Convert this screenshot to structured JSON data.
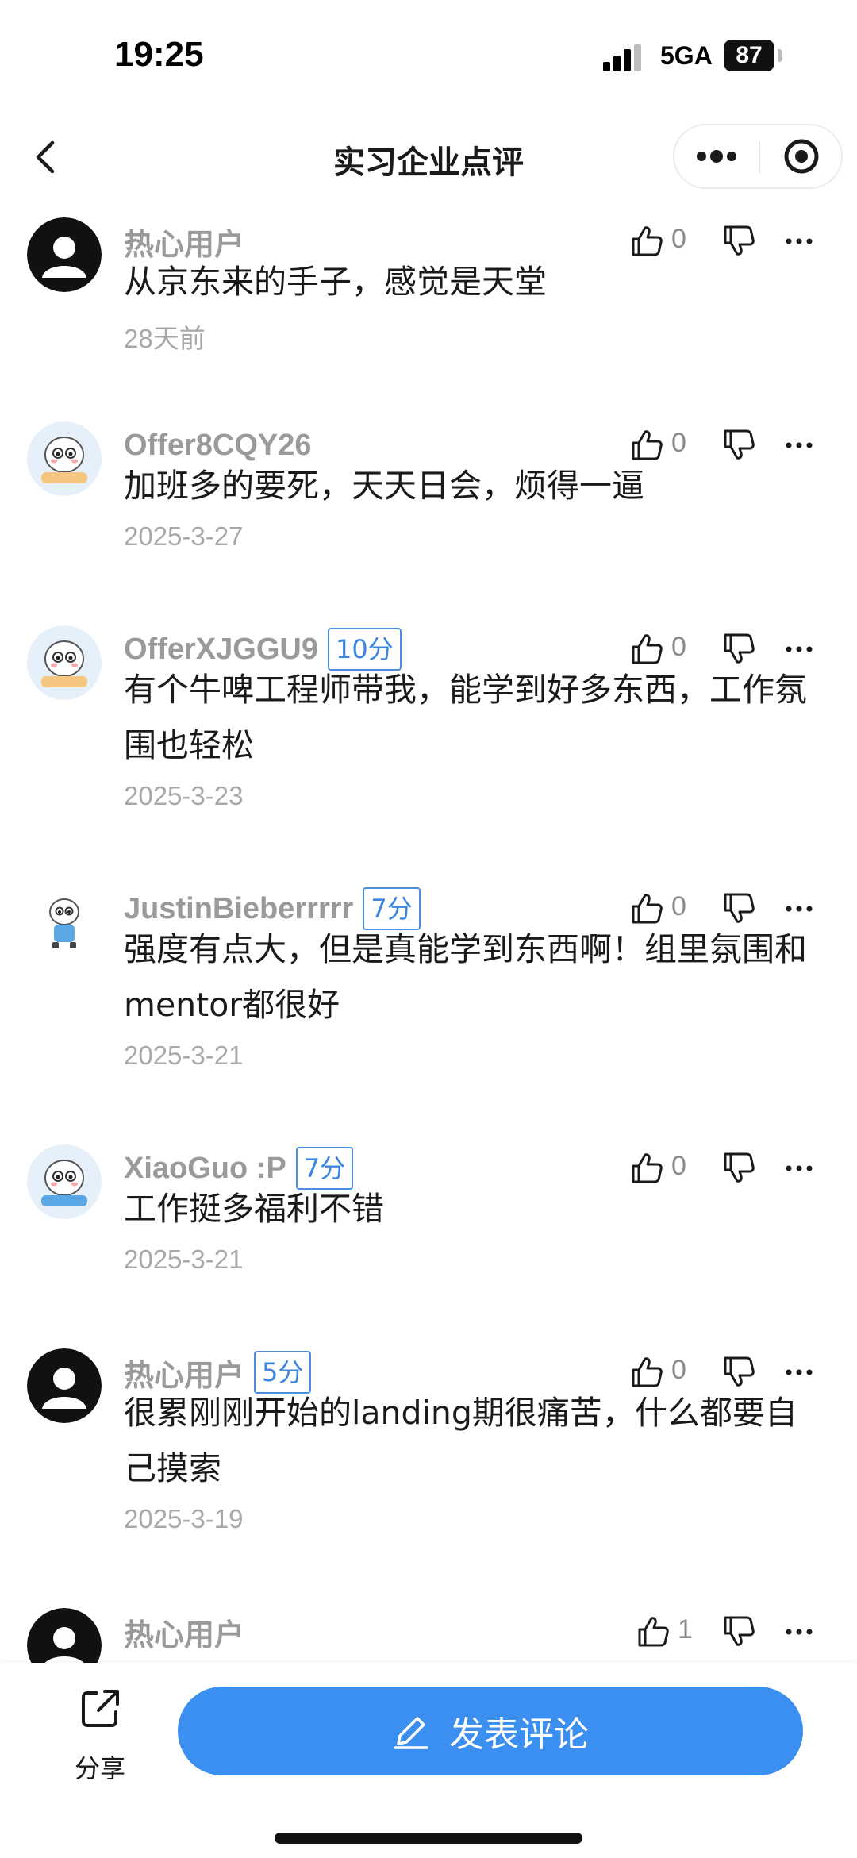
{
  "status_bar": {
    "time": "19:25",
    "network": "5GA",
    "battery": "87"
  },
  "nav": {
    "title": "实习企业点评",
    "back_icon": "chevron-left-icon",
    "menu_icon": "more-dots-icon",
    "close_icon": "target-circle-icon"
  },
  "comments": [
    {
      "username": "热心用户",
      "avatar": "default-user-avatar",
      "score": "",
      "likes": "0",
      "text": "从京东来的手子，感觉是天堂",
      "date": "28天前"
    },
    {
      "username": "Offer8CQY26",
      "avatar": "cartoon-mascot-avatar",
      "score": "",
      "likes": "0",
      "text": "加班多的要死，天天日会，烦得一逼",
      "date": "2025-3-27"
    },
    {
      "username": "OfferXJGGU9",
      "avatar": "cartoon-mascot-avatar",
      "score": "10分",
      "likes": "0",
      "text": "有个牛啤工程师带我，能学到好多东西，工作氛围也轻松",
      "date": "2025-3-23"
    },
    {
      "username": "JustinBieberrrrr",
      "avatar": "cartoon-mascot-small-avatar",
      "score": "7分",
      "likes": "0",
      "text": "强度有点大，但是真能学到东西啊！组里氛围和mentor都很好",
      "date": "2025-3-21"
    },
    {
      "username": "XiaoGuo :P",
      "avatar": "cartoon-mascot-avatar",
      "score": "7分",
      "likes": "0",
      "text": "工作挺多福利不错",
      "date": "2025-3-21"
    },
    {
      "username": "热心用户",
      "avatar": "default-user-avatar",
      "score": "5分",
      "likes": "0",
      "text": "很累刚刚开始的landing期很痛苦，什么都要自己摸索",
      "date": "2025-3-19"
    },
    {
      "username": "热心用户",
      "avatar": "default-user-avatar",
      "score": "",
      "likes": "1",
      "text": "",
      "date": ""
    }
  ],
  "bottom_bar": {
    "share_label": "分享",
    "post_label": "发表评论"
  },
  "colors": {
    "accent": "#3a8ff0",
    "badge": "#3a86e0",
    "username": "#9a9a9a",
    "date": "#a8a8a8"
  }
}
